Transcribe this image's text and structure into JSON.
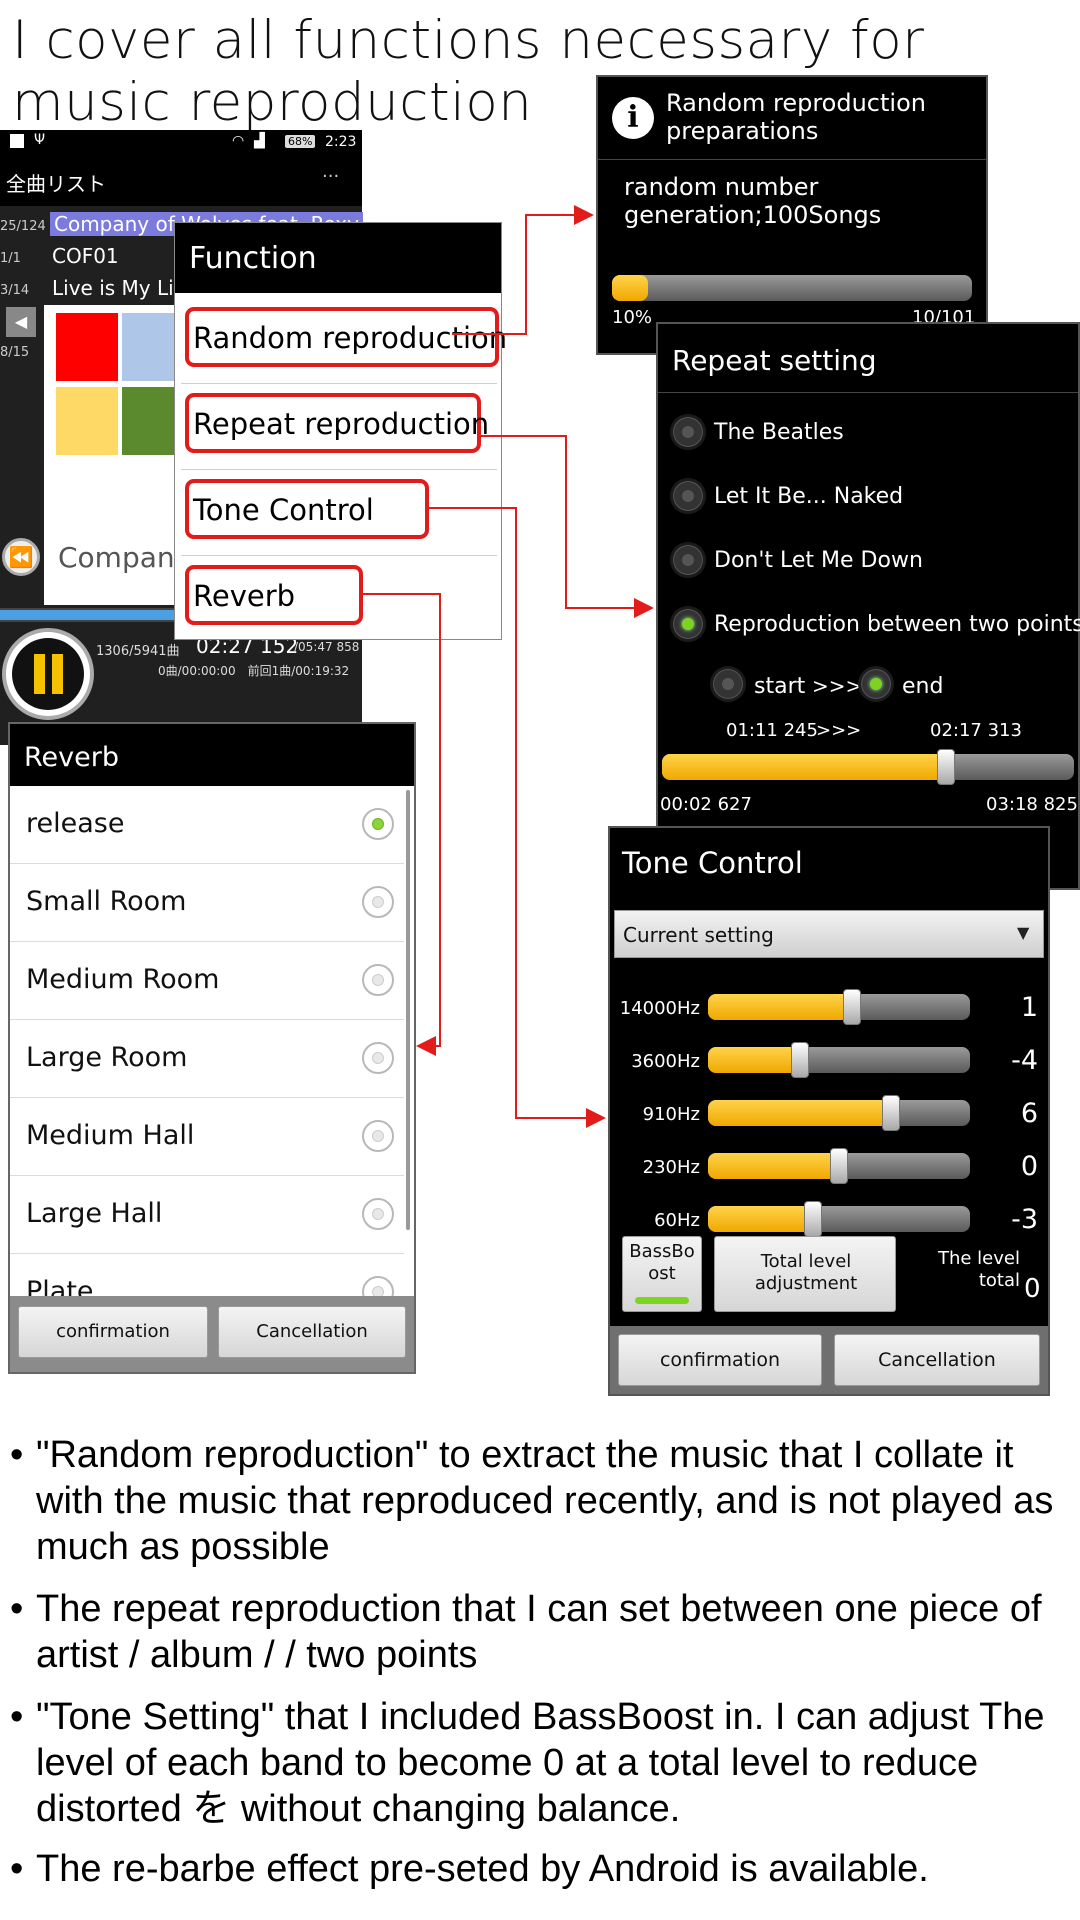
{
  "heading": "I cover all functions necessary for music reproduction",
  "player": {
    "status_time": "2:23",
    "battery": "68%",
    "list_title": "全曲リスト",
    "menu_dots": "···",
    "rows": [
      {
        "num": "25/124",
        "text": "Company of Wolves feat. Roxy"
      },
      {
        "num": "1/1",
        "text": "COF01"
      },
      {
        "num": "3/14",
        "text": "Live is My Li"
      },
      {
        "num": "8/15",
        "text": ""
      }
    ],
    "album_label": "Company",
    "counts": "1306/5941曲",
    "time_now": "02:27 152",
    "time_total": "/05:47 858",
    "sub_info": "0曲/00:00:00　前回1曲/00:19:32",
    "tile_colors": [
      "#ff0000",
      "#aec6e8",
      "#ffd966",
      "#5b8a2e"
    ],
    "progress": 0.82
  },
  "function_menu": {
    "title": "Function",
    "items": [
      "Random reproduction",
      "Repeat reproduction",
      "Tone Control",
      "Reverb"
    ]
  },
  "random_dialog": {
    "title": "Random reproduction preparations",
    "body": "random number generation;100Songs",
    "percent": "10%",
    "count": "10/101",
    "progress": 0.1
  },
  "repeat_dialog": {
    "title": "Repeat setting",
    "options": [
      "The Beatles",
      "Let It Be... Naked",
      "Don't Let Me Down",
      "Reproduction between two points"
    ],
    "selected": 3,
    "start_label": "start",
    "arrows": ">>>",
    "end_label": "end",
    "endpoint_selected": "end",
    "point_a": "01:11 245",
    "point_b": "02:17 313",
    "elapsed": "00:02 627",
    "duration": "03:18 825",
    "progress": 0.69
  },
  "tone_dialog": {
    "title": "Tone Control",
    "preset": "Current setting",
    "bands": [
      {
        "freq": "14000Hz",
        "value": "1",
        "level": 0.55
      },
      {
        "freq": "3600Hz",
        "value": "-4",
        "level": 0.35
      },
      {
        "freq": "910Hz",
        "value": "6",
        "level": 0.7
      },
      {
        "freq": "230Hz",
        "value": "0",
        "level": 0.5
      },
      {
        "freq": "60Hz",
        "value": "-3",
        "level": 0.4
      }
    ],
    "bassboost_label": "BassBoost",
    "bassboost_on": true,
    "total_level_button": "Total level adjustment",
    "total_label": "The level total",
    "total_value": "0",
    "confirm": "confirmation",
    "cancel": "Cancellation"
  },
  "reverb_dialog": {
    "title": "Reverb",
    "options": [
      "release",
      "Small Room",
      "Medium Room",
      "Large Room",
      "Medium Hall",
      "Large Hall",
      "Plate"
    ],
    "selected": 0,
    "confirm": "confirmation",
    "cancel": "Cancellation"
  },
  "bullets": [
    "\"Random reproduction\" to extract the music that I collate it with the music that reproduced recently, and is not played as much as possible",
    "The repeat reproduction that I can set between one piece of artist / album / / two points",
    "\"Tone Setting\" that I included BassBoost in. I can adjust The level of each band to become 0 at a total level to reduce distorted を without changing balance.",
    "The re-barbe effect pre-seted by Android is available."
  ],
  "bullet_symbol": "•",
  "colors": {
    "accent_red": "#e21b1b",
    "slider_yellow": "#f5b400",
    "radio_green": "#7ed321"
  }
}
